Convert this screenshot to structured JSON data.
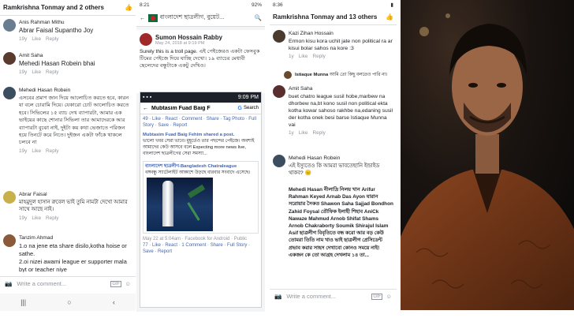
{
  "panel1": {
    "header_title": "Ramkrishna Tonmay and 2 others",
    "comments": [
      {
        "name": "Anis Rahman Mithu",
        "text": "Abrar Faisal Supantho Joy",
        "meta": [
          "19y",
          "Like",
          "Reply"
        ]
      },
      {
        "name": "Amit Saha",
        "text": "Mehedi Hasan Robein bhai",
        "meta": [
          "19y",
          "Like",
          "Reply"
        ]
      },
      {
        "name": "Mehedi Hasan Robein",
        "text": "এসবের প্রমাণ জান দিয়ে আলোচিত করতে হবে, কারন যা বলে চোরামি দিয়ে। যেকারো চোট আলোচিত করতে হবে। সিভিলের ১৫ ব্যাচ দেখ ব্যাপারটা, আমার এক ভাইয়ের কাছে শোনার সিভিলা তার আমাদেরকে আর ব্যাপারটা বুঝো নাই, দুইটা কয় কথা ভেজাতে পরিজন হয়ে তিনটে করে নিতে। দুইজন একটা ফাঁকে থাকলে চলবে না",
        "meta": [
          "19y",
          "Like",
          "Reply"
        ]
      },
      {
        "name": "Abrar Faisal",
        "text": "মাহমুদুল হাসান রুবেল ভাই তুমি নামটা দেখো আমার সাথে আছে নাই।",
        "meta": [
          "19y",
          "Like",
          "Reply"
        ]
      },
      {
        "name": "Tanzim Ahmad",
        "text": "1.o na jene eta share disilo,kotha hoise or sathe.",
        "text2": "2.oi nizei awami league er supporter mala byt or teacher niye",
        "meta": []
      }
    ],
    "write_placeholder": "Write a comment..."
  },
  "panel2": {
    "status_time": "8:21",
    "status_right": "92%",
    "group_name": "বাংলাদেশ ছাত্রলীগ, বুয়েট...",
    "poster": "Sumon Hossain Rabby",
    "post_time": "May 24, 2018 at 9:19 PM",
    "post_text": "Surely this is a troll page. এই পেইজেরও একটা ফেসবুক টিমের পেইজে দিয়ে যাচ্ছি দেখো। ১৯ ব্যাচের মেধাবী ছেলেদের বন্ধুটাকে একটু দেখিও।",
    "inner_status": "9:09 PM",
    "inner_search_name": "Mubtasim Fuad Baig F",
    "inner_search_label": "Search",
    "inner_reactions": "49 · Like · React · Comment · Share · Tag Photo · Full Story · Save · Report",
    "share_title": "Mubtasim Fuad Baig Fehim shared a post.",
    "share_text": "ভালো খবর সেরা ভাবে। মুহূর্তেও তার পছন্দের পেইজে। অবশ্যই আমাদের কেউ আসবে বলে Expecting more news live, বাংলাদেশ ছাত্রলীগের সেরা সমস্যা...",
    "share_box_title": "বাংলাদেশ ছাত্রলীগ-Bangladesh Chatraleague",
    "share_box_text": "বঙ্গবন্ধু স্যাটেলাইট আকাশে উড়ছে বারবার সংবাদে এসেছে।",
    "footer_time": "May 22 at 5:04am · Facebook for Android · Public",
    "footer_actions": "77 · Like · React · 1 Comment · Share · Full Story · Save · Report"
  },
  "panel3": {
    "header_title": "Ramkrishna Tonmay and 13 others",
    "status_time": "8:36",
    "comments": [
      {
        "name": "Kazi Zihan Hossain",
        "text": "Ermon kisu kora uchit jate non political ra ar kisui bolar sahos na kore :3",
        "meta": [
          "1y",
          "Like",
          "Reply"
        ]
      },
      {
        "name": "Istiaque Munna",
        "text": "আমি তো কিছু বলতেও পারি না।",
        "meta": []
      },
      {
        "name": "Amit Saha",
        "text": "buet chatro league susil hobe,marbew na dhorbew na,bt kono susil non political ekta kotha kowar sahoso rakhbe na,edaning susil der kotha onek besi barse Istiaque Munna vai",
        "meta": [
          "1y",
          "Like",
          "Reply"
        ]
      },
      {
        "name": "Mehedi Hasan Robein",
        "text": "এই ইস্যুতেও কি আমরা ভাবতেছানি ইন্ডাইড থাকব? 😐",
        "meta": []
      }
    ],
    "names_block": "Mehedi Hasan নীলাদ্রি নিলয় খান Arifur Rahman Keyed Arnab Das Ayon যারান সরোয়ার সৈকত Shawon Saha Sajjad Bondhon Zahid Foysal তৌফিক ইলাহী শিহাব AniCk Nawaze Mahmud Arnob Shifat Shams Arnob Chakraborty Soumik Shirajul Islam Asif ছাত্রলীগ বিবৃতিতে বন্ধ করো আর বড় কেউ তোমরা তিতি নাম খাও ভাই ছাত্রলীগ প্রেসিডেন্ট প্রভাব করার সাহস দেখাবো কোনও সময়ে নাই! একজন কে তো আগ্রহ দেখলাম ১৪ তা...",
    "write_placeholder": "Write a comment..."
  },
  "colors": {
    "fb_blue": "#4267b2",
    "meta_gray": "#90949c",
    "portrait_bg": "#151210",
    "shirt": "#7a3a1a"
  },
  "icons": [
    "thumbs-up-icon",
    "camera-icon",
    "emoji-icon",
    "gif-icon",
    "back-arrow-icon",
    "more-icon",
    "search-icon"
  ]
}
